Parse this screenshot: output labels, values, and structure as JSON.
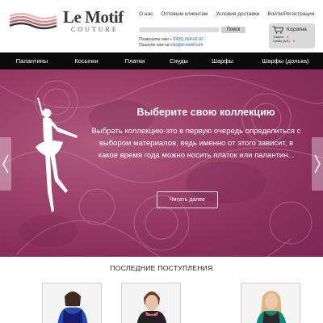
{
  "brand": {
    "name": "Le Motif",
    "tagline": "COUTURE"
  },
  "top_links": [
    "О нас",
    "Оптовым клиентам",
    "Условия доставки",
    "Войти/Регистрация"
  ],
  "search": {
    "placeholder": "",
    "button_label": "Поиск"
  },
  "contact": {
    "phone_prefix": "Позвоните нам ",
    "phone": "+7(495) 664-66-92",
    "email_prefix": "Пишите нам на ",
    "email": "info@le-motif.com"
  },
  "cart": {
    "label": "Корзина",
    "items_label": "Товаров",
    "items_value": "0",
    "sum_label": "Сумма (руб.)",
    "sum_value": "0"
  },
  "nav": [
    "Палантины",
    "Косынки",
    "Платки",
    "Снуды",
    "Шарфы",
    "Шарфы (долька)"
  ],
  "banner": {
    "title": "Выберите свою коллекцию",
    "text": "Выбрать коллекцию-это в первую очередь определиться с выбором материалов, ведь именно от этого зависит, в какое время года можно носить платок или палантин...",
    "button_label": "Читать далее"
  },
  "arrivals": {
    "title": "ПОСЛЕДНИЕ ПОСТУПЛЕНИЯ"
  },
  "colors": {
    "nav_bg": "#0b0b0b",
    "banner": "#9c3f69",
    "link": "#1f5ea8",
    "cart_value": "#cc0000"
  },
  "icons": [
    "cart-icon",
    "chevron-left-icon",
    "chevron-right-icon",
    "dancer-silhouette"
  ]
}
